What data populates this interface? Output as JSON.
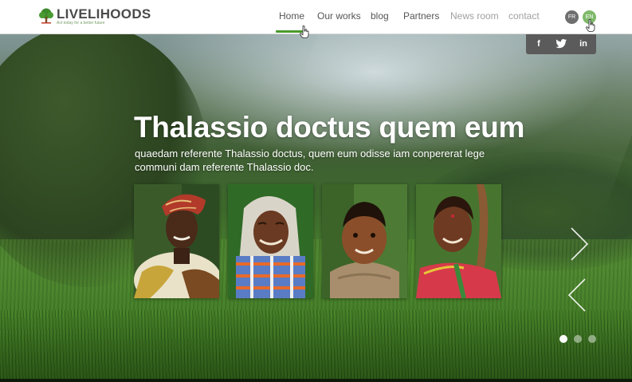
{
  "brand": {
    "name": "LIVELIHOODS",
    "tagline": "Act today for a better future"
  },
  "nav": {
    "items": [
      {
        "label": "Home",
        "active": true
      },
      {
        "label": "Our works",
        "active": false
      },
      {
        "label": "blog",
        "active": false
      },
      {
        "label": "Partners",
        "active": false
      },
      {
        "label": "News room",
        "active": false
      },
      {
        "label": "contact",
        "active": false
      }
    ]
  },
  "languages": {
    "fr": "FR",
    "en": "EN",
    "selected": "EN"
  },
  "social": {
    "facebook": "f",
    "twitter": "twitter-icon",
    "linkedin": "in"
  },
  "hero": {
    "title": "Thalassio doctus quem eum",
    "subtitle": "quaedam referente Thalassio doctus, quem eum odisse iam conpererat lege communi dam referente Thalassio doc.",
    "slides_total": 3,
    "slide_active": 1
  },
  "gallery": {
    "photos": [
      "woman-headscarf-photo",
      "elder-woman-plaid-shawl-photo",
      "child-smiling-photo",
      "woman-with-tool-photo"
    ]
  },
  "colors": {
    "accent": "#4a9a2a",
    "lang_en": "#7fb96a",
    "lang_fr": "#6f6f6f",
    "social_bar": "#5b5b5b"
  }
}
